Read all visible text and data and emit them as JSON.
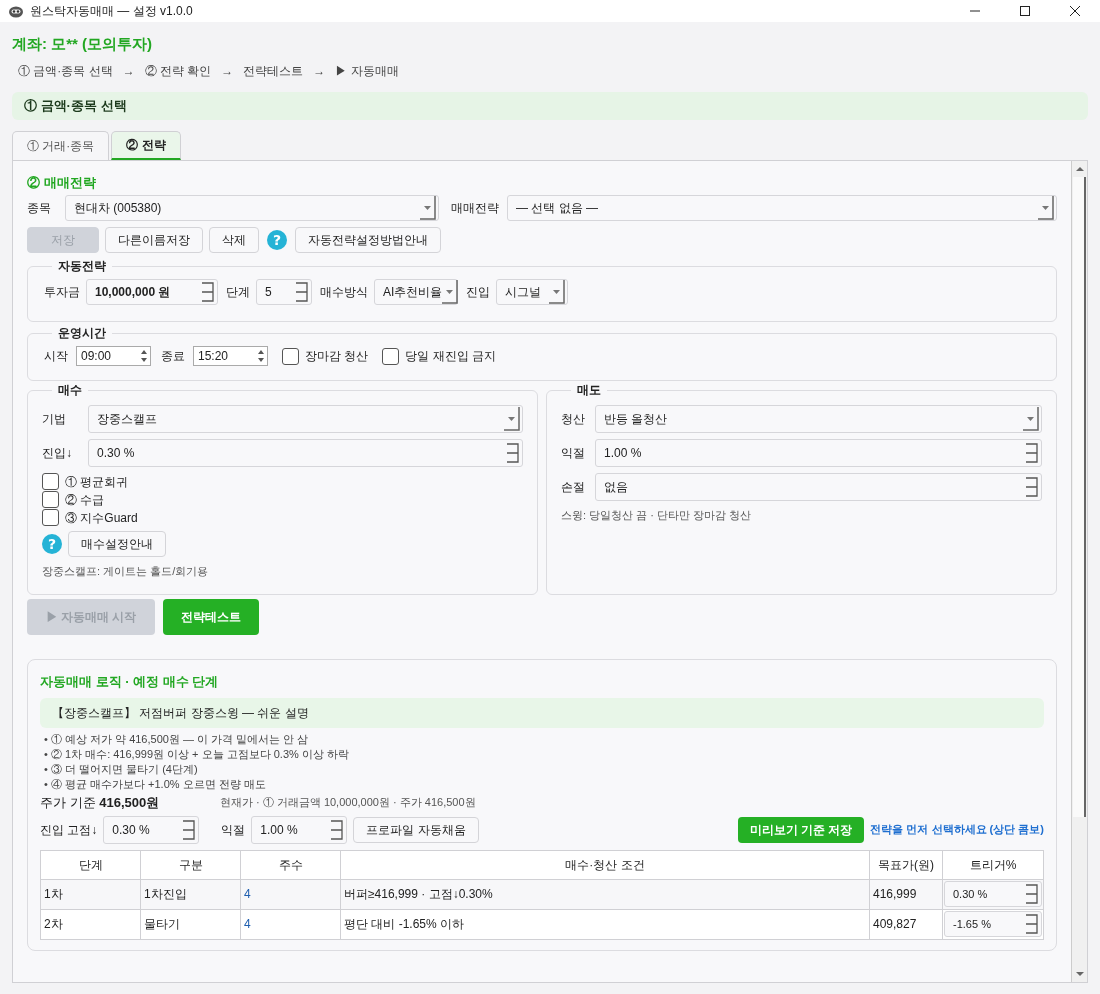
{
  "window": {
    "title": "원스탁자동매매 — 설정 v1.0.0"
  },
  "account": "계좌: 모** (모의투자)",
  "breadcrumb": [
    "① 금액·종목 선택",
    "→",
    "② 전략 확인",
    "→",
    "전략테스트",
    "→",
    "▶ 자동매매"
  ],
  "banner": "① 금액·종목 선택",
  "tabs": [
    {
      "label": "① 거래·종목",
      "selected": false
    },
    {
      "label": "② 전략",
      "selected": true
    }
  ],
  "section_title": "② 매매전략",
  "stock": {
    "label": "종목",
    "value": "현대차 (005380)"
  },
  "strategy": {
    "label": "매매전략",
    "value": "— 선택 없음 —"
  },
  "toolbar": [
    {
      "kind": "button",
      "label": "저장",
      "disabled": true
    },
    {
      "kind": "button",
      "label": "다른이름저장",
      "disabled": false
    },
    {
      "kind": "button",
      "label": "삭제",
      "disabled": false
    },
    {
      "kind": "help",
      "label": "?",
      "disabled": false
    },
    {
      "kind": "button",
      "label": "자동전략설정방법안내",
      "disabled": false
    }
  ],
  "auto_strategy": {
    "title": "자동전략",
    "fields": [
      {
        "kind": "spin",
        "label": "투자금",
        "value": "10,000,000 원"
      },
      {
        "kind": "spin",
        "label": "단계",
        "value": "5"
      },
      {
        "kind": "combo",
        "label": "매수방식",
        "value": "AI추천비율"
      },
      {
        "kind": "combo",
        "label": "진입",
        "value": "시그널"
      }
    ]
  },
  "operating_hours": {
    "title": "운영시간",
    "start": {
      "label": "시작",
      "value": "09:00"
    },
    "end": {
      "label": "종료",
      "value": "15:20"
    },
    "options": [
      {
        "label": "장마감 청산",
        "checked": false
      },
      {
        "label": "당일 재진입 금지",
        "checked": false
      }
    ]
  },
  "buy": {
    "title": "매수",
    "fields": [
      {
        "kind": "combo",
        "label": "기법",
        "value": "장중스캘프"
      },
      {
        "kind": "spin",
        "label": "진입↓",
        "value": "0.30 %"
      }
    ],
    "gates": [
      {
        "label": "① 평균회귀",
        "checked": false
      },
      {
        "label": "② 수급",
        "checked": false
      },
      {
        "label": "③ 지수Guard",
        "checked": false
      }
    ],
    "help": "?",
    "guide_button": "매수설정안내",
    "note": "장중스캘프: 게이트는 홀드/회기용"
  },
  "sell": {
    "title": "매도",
    "fields": [
      {
        "kind": "combo",
        "label": "청산",
        "value": "반등 올청산"
      },
      {
        "kind": "spin",
        "label": "익절",
        "value": "1.00 %"
      },
      {
        "kind": "spin",
        "label": "손절",
        "value": "없음"
      }
    ],
    "note": "스윙: 당일청산 끔 · 단타만 장마감 청산"
  },
  "actions": [
    {
      "label": "▶ 자동매매 시작",
      "disabled": true
    },
    {
      "label": "전략테스트",
      "disabled": false
    }
  ],
  "logic": {
    "title": "자동매매 로직 · 예정 매수 단계",
    "summary": "【장중스캘프】 저점버퍼 장중스윙 — 쉬운 설명",
    "bullets": [
      "• ① 예상 저가 약 416,500원 — 이 가격 밑에서는 안 삼",
      "• ② 1차 매수: 416,999원 이상 + 오늘 고점보다 0.3% 이상 하락",
      "• ③ 더 떨어지면 물타기 (4단계)",
      "• ④ 평균 매수가보다 +1.0% 오르면 전량 매도"
    ],
    "price_label": "주가 기준",
    "price": "416,500원",
    "price_info": "현재가 · ① 거래금액 10,000,000원 · 주가 416,500원",
    "entry": {
      "label": "진입 고점↓",
      "value": "0.30 %"
    },
    "take_profit": {
      "label": "익절",
      "value": "1.00 %"
    },
    "autofill_button": "프로파일 자동채움",
    "save_button": "미리보기 기준 저장",
    "hint": "전략을 먼저 선택하세요 (상단 콤보)",
    "table": {
      "columns": [
        "단계",
        "구분",
        "주수",
        "매수·청산 조건",
        "목표가(원)",
        "트리거%"
      ],
      "rows": [
        {
          "cells": [
            "1차",
            "1차진입",
            "4",
            "버퍼≥416,999 · 고점↓0.30%",
            "416,999"
          ],
          "trigger": "0.30 %"
        },
        {
          "cells": [
            "2차",
            "물타기",
            "4",
            "평단 대비 -1.65% 이하",
            "409,827"
          ],
          "trigger": "-1.65 %"
        }
      ]
    }
  }
}
